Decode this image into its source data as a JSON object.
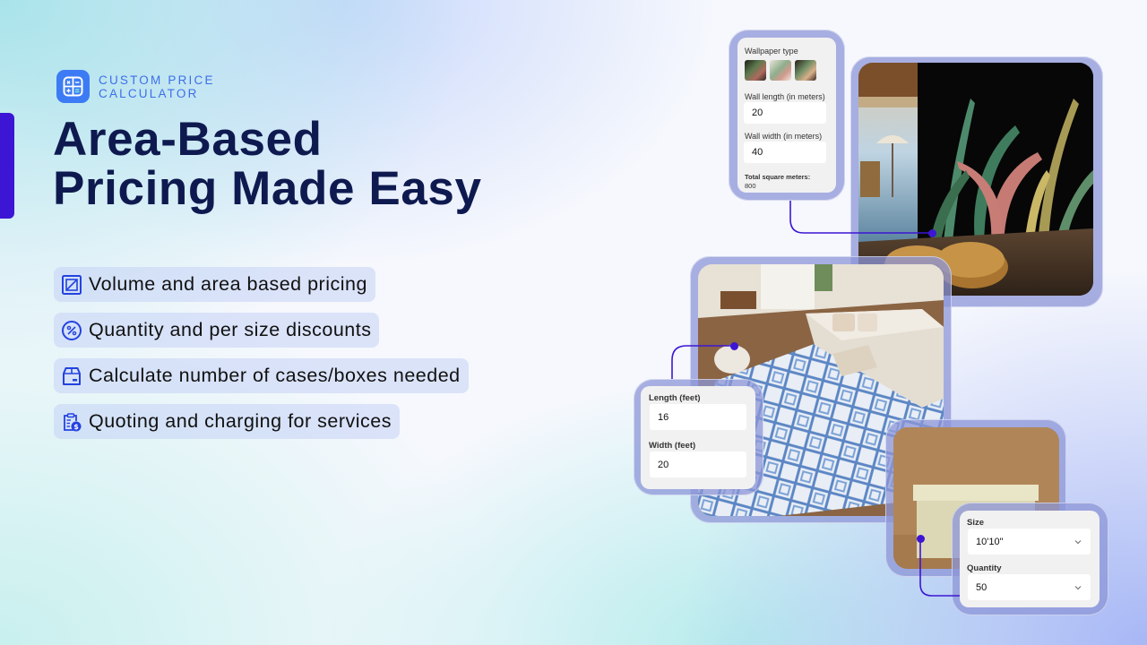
{
  "brand": {
    "line1": "CUSTOM PRICE",
    "line2": "CALCULATOR",
    "icon": "calculator-icon",
    "accent_color": "#3c16d4",
    "brand_color": "#3d7bf4"
  },
  "headline": {
    "line1": "Area-Based",
    "line2": "Pricing Made Easy"
  },
  "features": [
    {
      "icon": "area-square-icon",
      "label": "Volume and area based pricing"
    },
    {
      "icon": "percent-circle-icon",
      "label": "Quantity and per size discounts"
    },
    {
      "icon": "box-icon",
      "label": "Calculate number of cases/boxes needed"
    },
    {
      "icon": "clipboard-dollar-icon",
      "label": "Quoting and charging for services"
    }
  ],
  "wallpaper_panel": {
    "type_label": "Wallpaper type",
    "swatches": [
      "wallpaper-swatch-1",
      "wallpaper-swatch-2",
      "wallpaper-swatch-3"
    ],
    "length_label": "Wall length (in meters)",
    "length_value": "20",
    "width_label": "Wall width (in meters)",
    "width_value": "40",
    "total_label": "Total square meters:",
    "total_value": "800"
  },
  "rug_panel": {
    "length_label": "Length (feet)",
    "length_value": "16",
    "width_label": "Width (feet)",
    "width_value": "20"
  },
  "box_panel": {
    "size_label": "Size",
    "size_value": "10'10\"",
    "quantity_label": "Quantity",
    "quantity_value": "50"
  }
}
